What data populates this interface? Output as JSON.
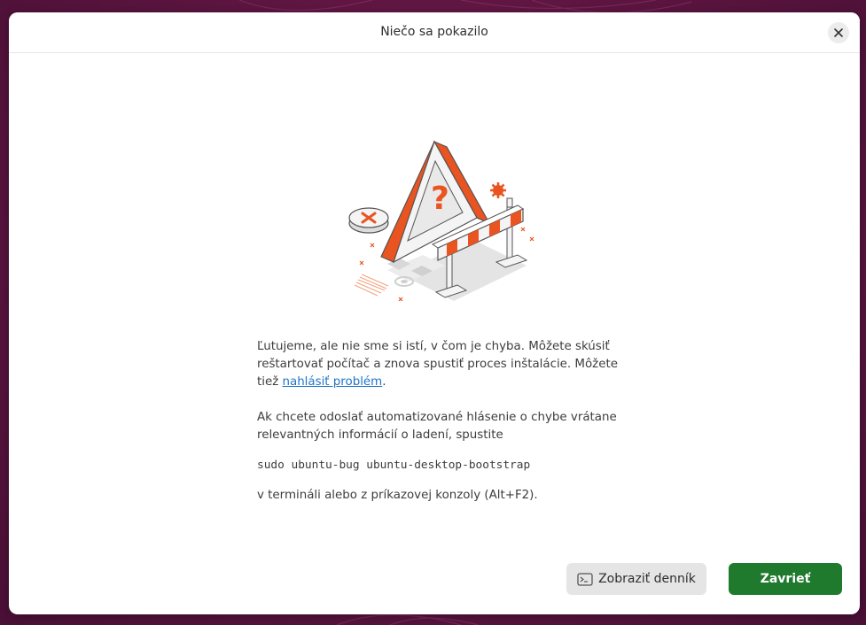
{
  "window": {
    "title": "Niečo sa pokazilo"
  },
  "message": {
    "p1_text": "Ľutujeme, ale nie sme si istí, v čom je chyba. Môžete skúsiť reštartovať počítač a znova spustiť proces inštalácie. Môžete tiež ",
    "p1_link": "nahlásiť problém",
    "p1_end": ".",
    "p2": "Ak chcete odoslať automatizované hlásenie o chybe vrátane relevantných informácií o ladení, spustite",
    "command": "sudo ubuntu-bug ubuntu-desktop-bootstrap",
    "p4": "v termináli alebo z príkazovej konzoly (Alt+F2)."
  },
  "buttons": {
    "show_log": "Zobraziť denník",
    "close": "Zavrieť"
  },
  "colors": {
    "accent_orange": "#e95420",
    "primary_green": "#1f7a2e",
    "link_blue": "#1f74c8",
    "background": "#5c1540"
  },
  "icons": {
    "close": "close-icon",
    "terminal": "terminal-icon",
    "illustration": "warning-barrier-illustration"
  }
}
